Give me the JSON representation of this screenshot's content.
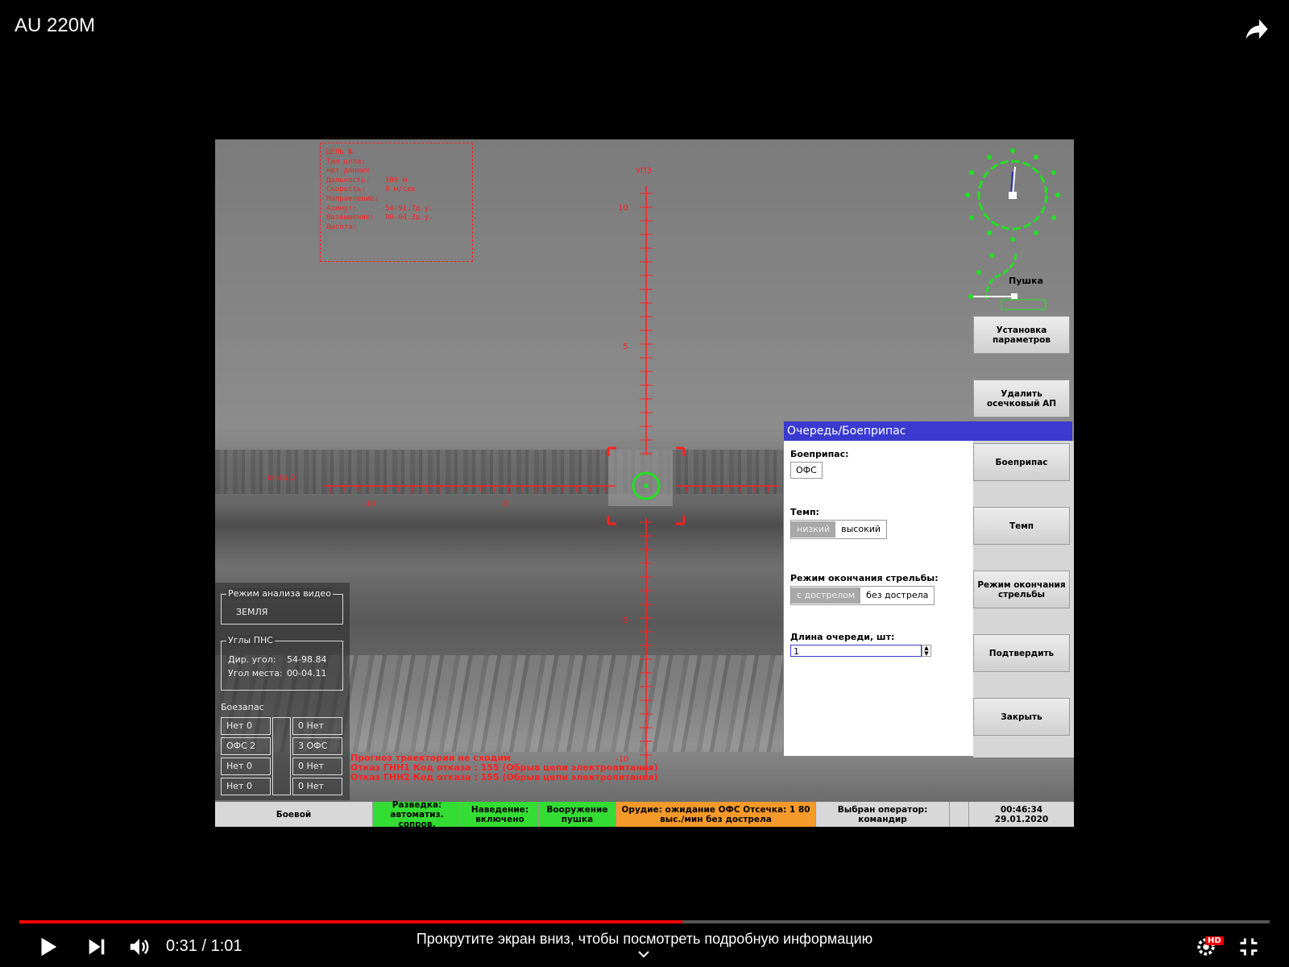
{
  "video": {
    "title": "AU 220M",
    "time_current": "0:31",
    "time_total": "1:01",
    "time_sep": " / ",
    "progress_fraction": 0.53,
    "scroll_hint": "Прокрутите экран вниз, чтобы посмотреть подробную информацию",
    "hd_badge": "HD"
  },
  "target": {
    "rows": [
      [
        "ЦЕЛЬ №",
        ""
      ],
      [
        "Тип цели:",
        ""
      ],
      [
        "нет данных",
        ""
      ],
      [
        "Дальность:",
        "100 м"
      ],
      [
        "Скорость:",
        "0 м/сек"
      ],
      [
        "Направление:",
        ""
      ],
      [
        "Азимут:",
        "54-91.7д.у."
      ],
      [
        "Возвышение:",
        "00-04.2д.у."
      ],
      [
        "Высота:",
        ""
      ]
    ]
  },
  "reticle": {
    "top_label": "УП3",
    "left_label": "00-04.2",
    "v_ticks": [
      "10",
      "5",
      "-5",
      "-10"
    ],
    "h_ticks": [
      "-10",
      "-5"
    ]
  },
  "compass": {
    "label": "Пушка"
  },
  "side_buttons": [
    "Установка параметров",
    "Удалить осечковый АП"
  ],
  "dialog": {
    "title": "Очередь/Боеприпас",
    "ammo_label": "Боеприпас:",
    "ammo_value": "ОФС",
    "rate_label": "Темп:",
    "rate_options": [
      "низкий",
      "высокий"
    ],
    "end_label": "Режим окончания стрельбы:",
    "end_options": [
      "с дострелом",
      "без дострела"
    ],
    "burst_label": "Длина очереди, шт:",
    "burst_value": "1",
    "buttons": [
      "Боеприпас",
      "Темп",
      "Режим окончания стрельбы",
      "Подтвердить",
      "Закрыть"
    ]
  },
  "left_panel": {
    "video_mode_legend": "Режим анализа видео",
    "video_mode_value": "ЗЕМЛЯ",
    "angles_legend": "Углы ПНС",
    "dir_angle_label": "Дир. угол:",
    "dir_angle_value": "54-98.84",
    "elev_label": "Угол места:",
    "elev_value": "00-04.11",
    "ammo_title": "Боезапас",
    "ammo_left": [
      "Нет 0",
      "ОФС 2",
      "Нет 0",
      "Нет 0"
    ],
    "ammo_right": [
      "0 Нет",
      "3 ОФС",
      "0 Нет",
      "0 Нет"
    ]
  },
  "errors": [
    "Прогноз траектории не сходим",
    "Отказ ГНН1 Код отказа : 155 (Обрыв цепи электропитания)",
    "Отказ ГНН2 Код отказа : 155 (Обрыв цепи электропитания)"
  ],
  "status": {
    "mode": "Боевой",
    "recon": "Разведка: автоматиз. сопров.",
    "aim": "Наведение: включено",
    "weapon": "Вооружение пушка",
    "gun": "Орудие: ожидание ОФС Отсечка: 1 80 выс./мин без дострела",
    "operator": "Выбран оператор: командир",
    "time": "00:46:34",
    "date": "29.01.2020"
  },
  "colors": {
    "status_green": "#33dd33",
    "status_orange": "#f59a2a",
    "reticle_red": "#ff2020",
    "compass_green": "#22e022",
    "dialog_title": "#3a3ad0"
  }
}
